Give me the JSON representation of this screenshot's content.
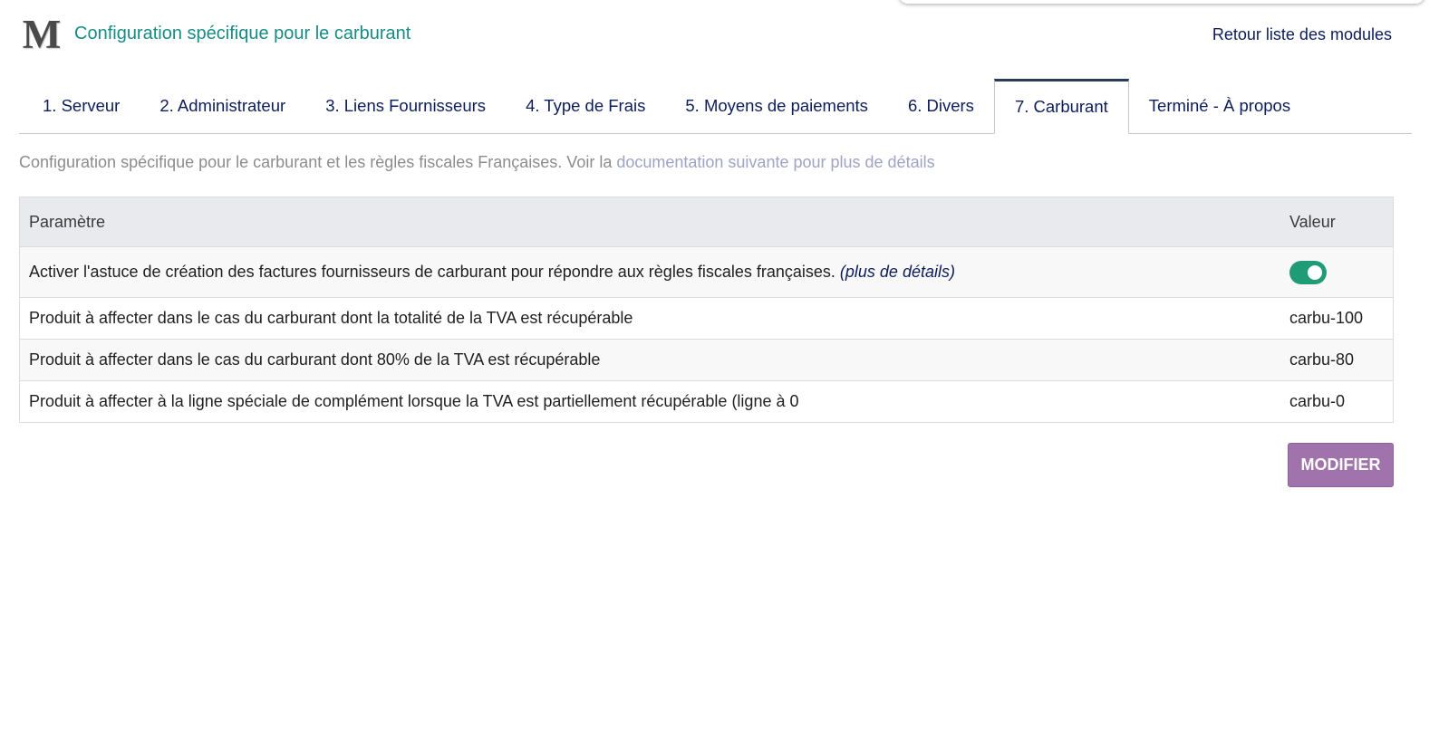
{
  "header": {
    "logo_letter": "M",
    "title": "Configuration spécifique pour le carburant",
    "back_link": "Retour liste des modules"
  },
  "tabs": [
    {
      "label": "1. Serveur",
      "active": false
    },
    {
      "label": "2. Administrateur",
      "active": false
    },
    {
      "label": "3. Liens Fournisseurs",
      "active": false
    },
    {
      "label": "4. Type de Frais",
      "active": false
    },
    {
      "label": "5. Moyens de paiements",
      "active": false
    },
    {
      "label": "6. Divers",
      "active": false
    },
    {
      "label": "7. Carburant",
      "active": true
    },
    {
      "label": "Terminé - À propos",
      "active": false
    }
  ],
  "description": {
    "text": "Configuration spécifique pour le carburant et les règles fiscales Françaises. Voir la ",
    "link": "documentation suivante pour plus de détails"
  },
  "table": {
    "headers": {
      "param": "Paramètre",
      "value": "Valeur"
    },
    "rows": [
      {
        "label": "Activer l'astuce de création des factures fournisseurs de carburant pour répondre aux règles fiscales françaises. ",
        "link": "(plus de détails)",
        "toggle_on": true
      },
      {
        "label": "Produit à affecter dans le cas du carburant dont la totalité de la TVA est récupérable",
        "value": "carbu-100"
      },
      {
        "label": "Produit à affecter dans le cas du carburant dont 80% de la TVA est récupérable",
        "value": "carbu-80"
      },
      {
        "label": "Produit à affecter à la ligne spéciale de complément lorsque la TVA est partiellement récupérable (ligne à 0",
        "value": "carbu-0"
      }
    ]
  },
  "actions": {
    "modify_label": "MODIFIER"
  },
  "colors": {
    "title": "#178c85",
    "link": "#0d1d5a",
    "toggle_on": "#1f9b76",
    "button": "#a173ac",
    "active_tab_border": "#263c5c"
  }
}
